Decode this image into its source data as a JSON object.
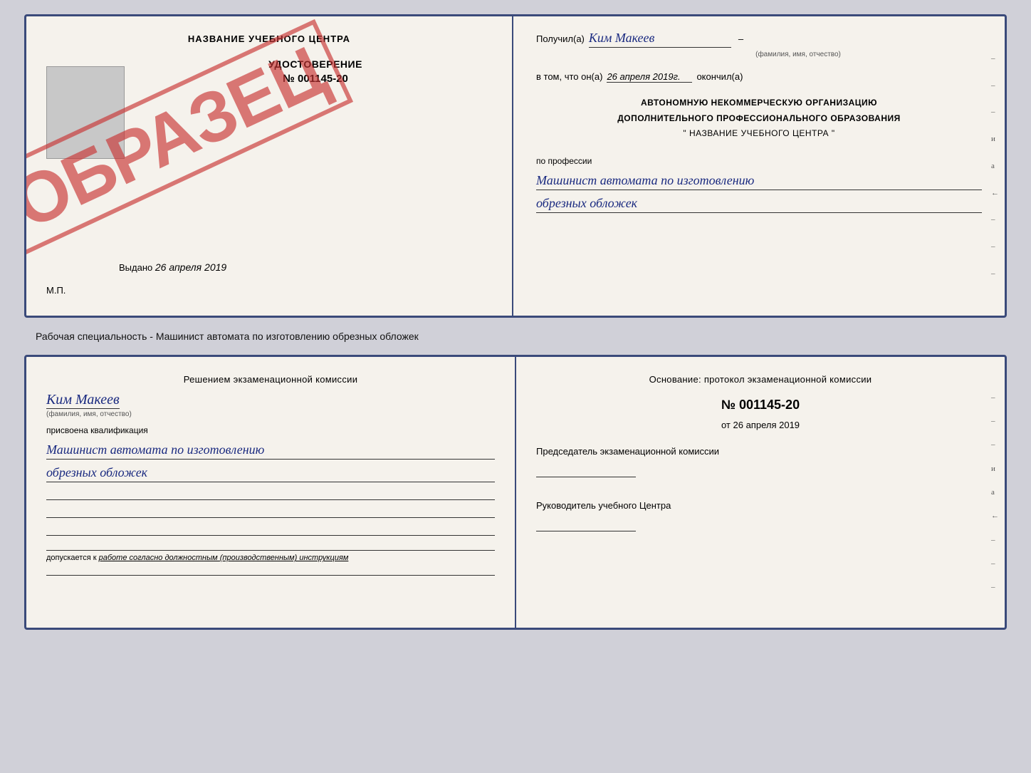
{
  "top_doc": {
    "left": {
      "training_center": "НАЗВАНИЕ УЧЕБНОГО ЦЕНТРА",
      "udostoverenie_label": "УДОСТОВЕРЕНИЕ",
      "number": "№ 001145-20",
      "vydano_label": "Выдано",
      "vydano_date": "26 апреля 2019",
      "mp": "М.П.",
      "obrazec": "ОБРАЗЕЦ"
    },
    "right": {
      "poluchil_label": "Получил(а)",
      "poluchil_name": "Ким Макеев",
      "fio_hint": "(фамилия, имя, отчество)",
      "dash": "–",
      "v_tom_label": "в том, что он(а)",
      "date_value": "26 апреля 2019г.",
      "okonchil": "окончил(а)",
      "org_line1": "АВТОНОМНУЮ НЕКОММЕРЧЕСКУЮ ОРГАНИЗАЦИЮ",
      "org_line2": "ДОПОЛНИТЕЛЬНОГО ПРОФЕССИОНАЛЬНОГО ОБРАЗОВАНИЯ",
      "org_line3": "\"   НАЗВАНИЕ УЧЕБНОГО ЦЕНТРА   \"",
      "po_professii": "по профессии",
      "profession_line1": "Машинист автомата по изготовлению",
      "profession_line2": "обрезных обложек",
      "dashes": [
        "–",
        "–",
        "–",
        "и",
        "а",
        "←",
        "–",
        "–",
        "–"
      ]
    }
  },
  "between_label": "Рабочая специальность - Машинист автомата по изготовлению обрезных обложек",
  "bottom_doc": {
    "left": {
      "reshen_label": "Решением экзаменационной комиссии",
      "name": "Ким Макеев",
      "fio_hint": "(фамилия, имя, отчество)",
      "prisvoena": "присвоена квалификация",
      "profession_line1": "Машинист автомата по изготовлению",
      "profession_line2": "обрезных обложек",
      "blank_lines": [
        "",
        "",
        ""
      ],
      "dopuskaetsya_label": "допускается к",
      "dopuskaetsya_value": "работе согласно должностным (производственным) инструкциям",
      "bottom_line": ""
    },
    "right": {
      "osnovanie_label": "Основание: протокол экзаменационной комиссии",
      "protocol_number": "№  001145-20",
      "ot_label": "от",
      "ot_date": "26 апреля 2019",
      "predsedatel_label": "Председатель экзаменационной комиссии",
      "rukovoditel_label": "Руководитель учебного Центра",
      "dashes": [
        "–",
        "–",
        "–",
        "и",
        "а",
        "←",
        "–",
        "–",
        "–"
      ]
    }
  }
}
